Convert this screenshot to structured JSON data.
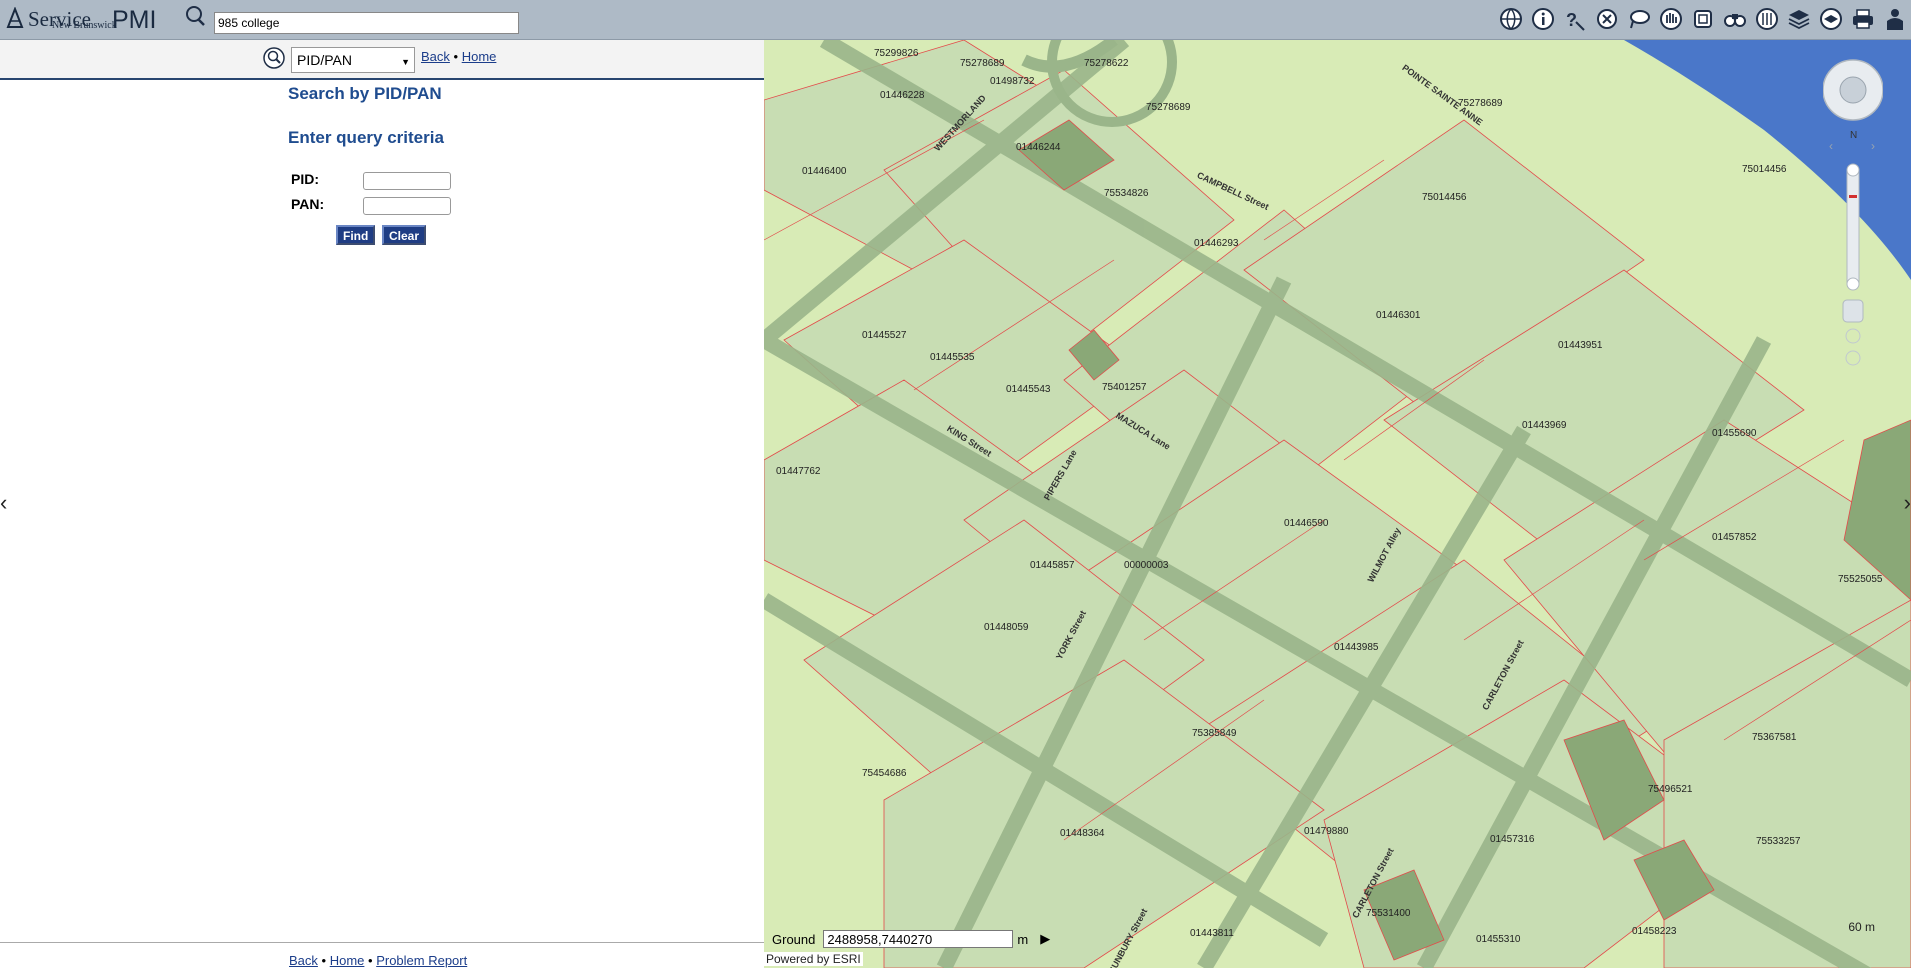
{
  "header": {
    "logo_text": "Service",
    "logo_sub": "New Brunswick",
    "app_name": "PMI",
    "search_value": "985 college",
    "tools": [
      "globe-icon",
      "info-icon",
      "help-icon",
      "close-icon",
      "lasso-icon",
      "hand-icon",
      "extent-icon",
      "binoculars-icon",
      "measure-icon",
      "layers-icon",
      "basemap-icon",
      "print-icon",
      "user-icon"
    ]
  },
  "panel": {
    "search_type": "PID/PAN",
    "back": "Back",
    "home": "Home",
    "title": "Search by PID/PAN",
    "subtitle": "Enter query criteria",
    "pid_label": "PID:",
    "pan_label": "PAN:",
    "find": "Find",
    "clear": "Clear",
    "footer_back": "Back",
    "footer_home": "Home",
    "footer_report": "Problem Report"
  },
  "map": {
    "coord_label": "Ground",
    "coord_value": "2488958,7440270",
    "coord_unit": "m",
    "powered": "Powered by ESRI",
    "scale": "60 m",
    "parcels": [
      "75299826",
      "75278689",
      "75278622",
      "01446228",
      "01498732",
      "75278689",
      "75278689",
      "01446244",
      "01446400",
      "75534826",
      "01446293",
      "75014456",
      "75014456",
      "01446301",
      "01443951",
      "01445527",
      "01445535",
      "01445543",
      "75401257",
      "01443969",
      "01455690",
      "01447762",
      "01445857",
      "00000003",
      "01446590",
      "01457852",
      "75525055",
      "01448059",
      "01443985",
      "75367581",
      "75496521",
      "75385849",
      "75454686",
      "01448364",
      "01479880",
      "01457316",
      "75533257",
      "01443811",
      "75531400",
      "01455310",
      "01458223"
    ],
    "streets": [
      "WESTMORLAND",
      "CAMPBELL Street",
      "POINTE SAINTE ANNE",
      "KING Street",
      "MAZUCA Lane",
      "PIPERS Lane",
      "YORK Street",
      "WILMOT Alley",
      "CARLETON Street",
      "CARLETON Street",
      "SUNBURY Street"
    ]
  }
}
